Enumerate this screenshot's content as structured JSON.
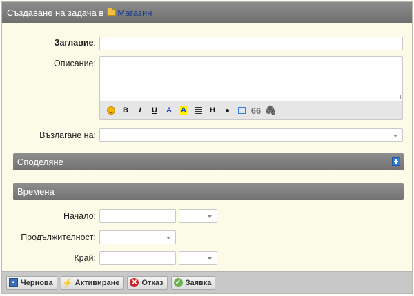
{
  "dialog": {
    "title_prefix": "Създаване на задача в",
    "project_name": "Магазин"
  },
  "form": {
    "title_label": "Заглавие",
    "title_value": "",
    "description_label": "Описание:",
    "description_value": "",
    "assign_label": "Възлагане на:",
    "assign_value": "",
    "toolbar": {
      "bold": "B",
      "italic": "I",
      "underline": "U",
      "color": "A",
      "highlight": "A",
      "heading": "H",
      "quote": "66",
      "attach": "🖇"
    }
  },
  "sections": {
    "sharing": "Споделяне",
    "times": "Времена"
  },
  "times": {
    "start_label": "Начало:",
    "duration_label": "Продължителност:",
    "end_label": "Край:"
  },
  "footer": {
    "draft": "Чернова",
    "activate": "Активиране",
    "cancel": "Отказ",
    "request": "Заявка"
  }
}
